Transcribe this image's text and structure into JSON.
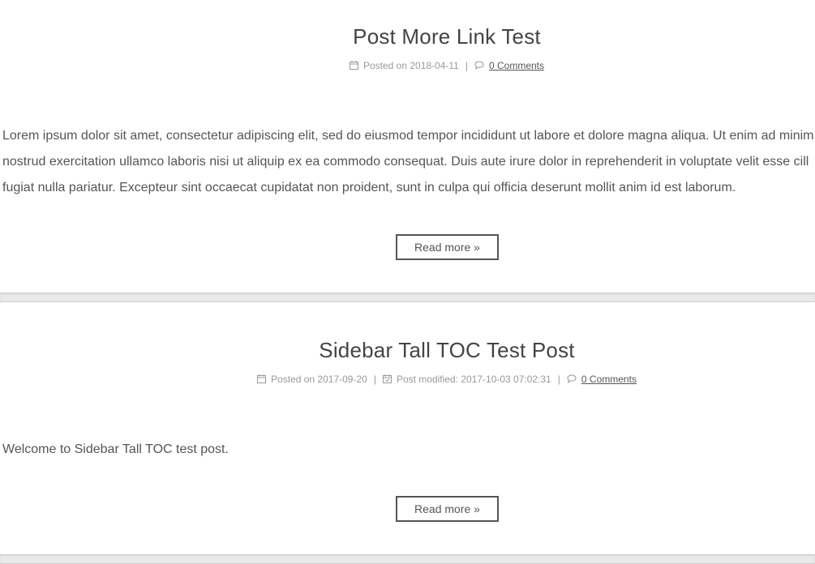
{
  "posts": [
    {
      "title": "Post More Link Test",
      "posted_on": "Posted on 2018-04-11",
      "comments": "0 Comments",
      "content": [
        "Lorem ipsum dolor sit amet, consectetur adipiscing elit, sed do eiusmod tempor incididunt ut labore et dolore magna aliqua. Ut enim ad minim",
        "nostrud exercitation ullamco laboris nisi ut aliquip ex ea commodo consequat. Duis aute irure dolor in reprehenderit in voluptate velit esse cill",
        "fugiat nulla pariatur. Excepteur sint occaecat cupidatat non proident, sunt in culpa qui officia deserunt mollit anim id est laborum."
      ],
      "read_more": "Read more »"
    },
    {
      "title": "Sidebar Tall TOC Test Post",
      "posted_on": "Posted on 2017-09-20",
      "modified": "Post modified: 2017-10-03 07:02:31",
      "comments": "0 Comments",
      "content": [
        "Welcome to Sidebar Tall TOC test post."
      ],
      "read_more": "Read more »"
    }
  ],
  "meta_separator": "|",
  "icons": {
    "calendar": "calendar-icon",
    "calendar_check": "calendar-check-icon",
    "comment": "comment-icon"
  },
  "colors": {
    "title": "#444444",
    "meta": "#999999",
    "body_text": "#555555",
    "divider": "#e9e9e9"
  }
}
